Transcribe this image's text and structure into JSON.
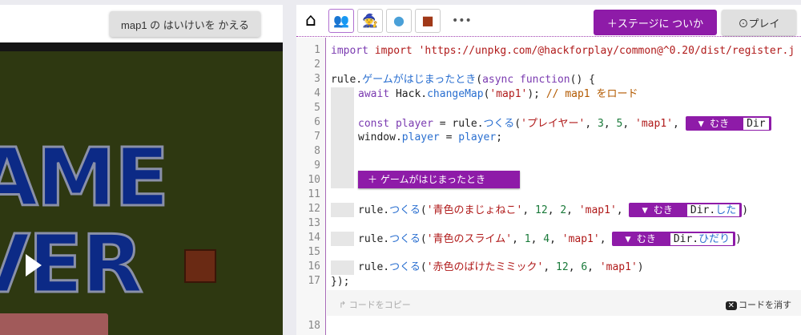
{
  "left": {
    "map_button": "map1 の はいけいを かえる",
    "game_text": [
      "AME",
      "VER"
    ]
  },
  "toolbar": {
    "tools": [
      "heroes",
      "wizard",
      "slime",
      "chest"
    ],
    "more": "•••",
    "add_stage": "＋ステージに ついか",
    "play": "プレイ"
  },
  "code": {
    "lines": [
      "1",
      "2",
      "3",
      "4",
      "5",
      "6",
      "7",
      "8",
      "9",
      "10",
      "11",
      "12",
      "13",
      "14",
      "15",
      "16",
      "17",
      "18"
    ],
    "l1": "import 'https://unpkg.com/@hackforplay/common@^0.20/dist/register.j",
    "l3a": "rule.",
    "l3b": "ゲームがはじまったとき",
    "l3c": "(",
    "l3d": "async function",
    "l3e": "() {",
    "l4a": "await ",
    "l4b": "Hack.",
    "l4c": "changeMap",
    "l4d": "(",
    "l4e": "'map1'",
    "l4f": "); ",
    "l4g": "// map1 をロード",
    "l6a": "const player",
    "l6b": " = rule.",
    "l6c": "つくる",
    "l6d": "(",
    "l6e": "'プレイヤー'",
    "l6f": ", ",
    "l6g": "3",
    "l6h": ", ",
    "l6i": "5",
    "l6j": ", ",
    "l6k": "'map1'",
    "l6l": ", ",
    "l6dir": "Dir",
    "l7a": "window.",
    "l7b": "player",
    "l7c": " = ",
    "l7d": "player",
    "l7e": ";",
    "add_rule": "＋ ゲームがはじまったとき",
    "r12": {
      "name": "'青色のまじょねこ'",
      "x": "12",
      "y": "2",
      "dir_prefix": "Dir.",
      "dir": "した"
    },
    "r14": {
      "name": "'青色のスライム'",
      "x": "1",
      "y": "4",
      "dir_prefix": "Dir.",
      "dir": "ひだり"
    },
    "r16": {
      "name": "'赤色のばけたミミック'",
      "x": "12",
      "y": "6"
    },
    "rule": "rule.",
    "tsukuru": "つくる",
    "map": "'map1'",
    "muki": "▼ むき",
    "close": "});"
  },
  "bottom": {
    "copy": "コードをコピー",
    "clear": "コードを消す"
  }
}
